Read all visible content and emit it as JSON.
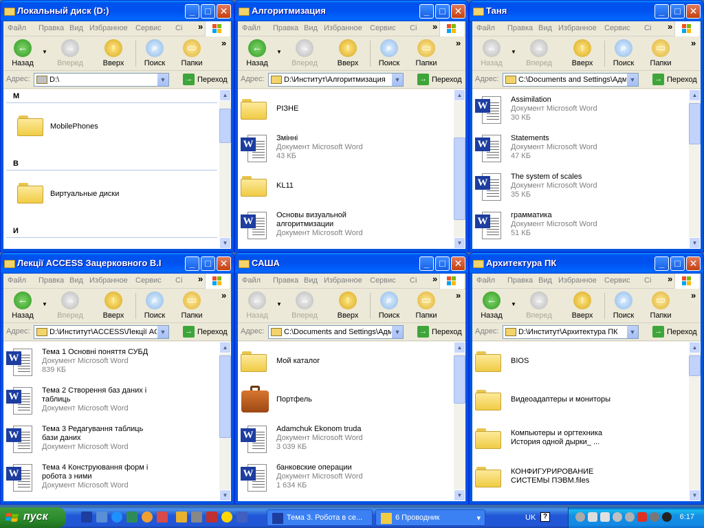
{
  "menu": [
    "Файл",
    "Правка",
    "Вид",
    "Избранное",
    "Сервис",
    "Сі"
  ],
  "toolbar": {
    "back": "Назад",
    "forward": "Вперед",
    "up": "Вверх",
    "search": "Поиск",
    "folders": "Папки"
  },
  "address_label": "Адрес:",
  "go_label": "Переход",
  "windows": [
    {
      "title": "Локальный диск (D:)",
      "address": "D:\\",
      "groups": [
        {
          "letter": "M"
        },
        {
          "letter": "B"
        },
        {
          "letter": "И"
        }
      ],
      "items": [
        {
          "name": "MobilePhones",
          "kind": "folder"
        },
        {
          "name": "Виртуальные диски",
          "kind": "folder"
        }
      ]
    },
    {
      "title": "Алгоритмизация",
      "address": "D:\\Институт\\Алгоритмизация",
      "items": [
        {
          "name": "РІЗНЕ",
          "kind": "folder"
        },
        {
          "name": "Змінні",
          "kind": "word",
          "type": "Документ Microsoft Word",
          "size": "43 КБ"
        },
        {
          "name": "KL11",
          "kind": "folder"
        },
        {
          "name": "Основы визуальной",
          "name2": "алгоритмизации",
          "kind": "word",
          "type": "Документ Microsoft Word"
        }
      ]
    },
    {
      "title": "Таня",
      "address": "C:\\Documents and Settings\\Админ",
      "items": [
        {
          "name": "Assimilation",
          "kind": "word",
          "type": "Документ Microsoft Word",
          "size": "30 КБ"
        },
        {
          "name": "Statements",
          "kind": "word",
          "type": "Документ Microsoft Word",
          "size": "47 КБ"
        },
        {
          "name": "The system of scales",
          "kind": "word",
          "type": "Документ Microsoft Word",
          "size": "35 КБ"
        },
        {
          "name": "грамматика",
          "kind": "word",
          "type": "Документ Microsoft Word",
          "size": "51 КБ"
        }
      ]
    },
    {
      "title": "Лекції ACCESS Зацерковного В.І",
      "address": "D:\\Институт\\ACCESS\\Лекції ACCE",
      "items": [
        {
          "name": "Тема 1 Основні поняття СУБД",
          "kind": "word",
          "type": "Документ Microsoft Word",
          "size": "839 КБ"
        },
        {
          "name": "Тема 2 Створення баз даних  і",
          "name2": "таблиць",
          "kind": "word",
          "type": "Документ Microsoft Word"
        },
        {
          "name": "Тема 3 Редагування таблиць",
          "name2": "бази даних",
          "kind": "word",
          "type": "Документ Microsoft Word"
        },
        {
          "name": "Тема 4 Конструювання форм і",
          "name2": "робота з ними",
          "kind": "word",
          "type": "Документ Microsoft Word"
        }
      ]
    },
    {
      "title": "САША",
      "address": "C:\\Documents and Settings\\Админ",
      "items": [
        {
          "name": "Мой каталог",
          "kind": "folder"
        },
        {
          "name": "Портфель",
          "kind": "briefcase"
        },
        {
          "name": "Adamchuk Ekonom truda",
          "kind": "word",
          "type": "Документ Microsoft Word",
          "size": "3 039 КБ"
        },
        {
          "name": "банковские операции",
          "kind": "word",
          "type": "Документ Microsoft Word",
          "size": "1 634 КБ"
        }
      ]
    },
    {
      "title": "Архитектура ПК",
      "address": "D:\\Институт\\Архитектура ПК",
      "items": [
        {
          "name": "BIOS",
          "kind": "folder"
        },
        {
          "name": "Видеоадаптеры и мониторы",
          "kind": "folder"
        },
        {
          "name": "Компьютеры и оргтехника",
          "name2": "История одной дырки_ ...",
          "kind": "folder"
        },
        {
          "name": "КОНФИГУРИРОВАНИЕ",
          "name2": "СИСТЕМЫ ПЭВМ.files",
          "kind": "folder"
        }
      ]
    }
  ],
  "taskbar": {
    "start": "пуск",
    "tasks": [
      {
        "label": "Тема 3. Робота в се..."
      },
      {
        "label": "6 Проводник"
      }
    ],
    "lang": "UK",
    "clock": "6:17"
  },
  "colors": {
    "desktop": "#3a6ea5",
    "titlebar": "#0054e3",
    "start": "#3c9a3c"
  }
}
